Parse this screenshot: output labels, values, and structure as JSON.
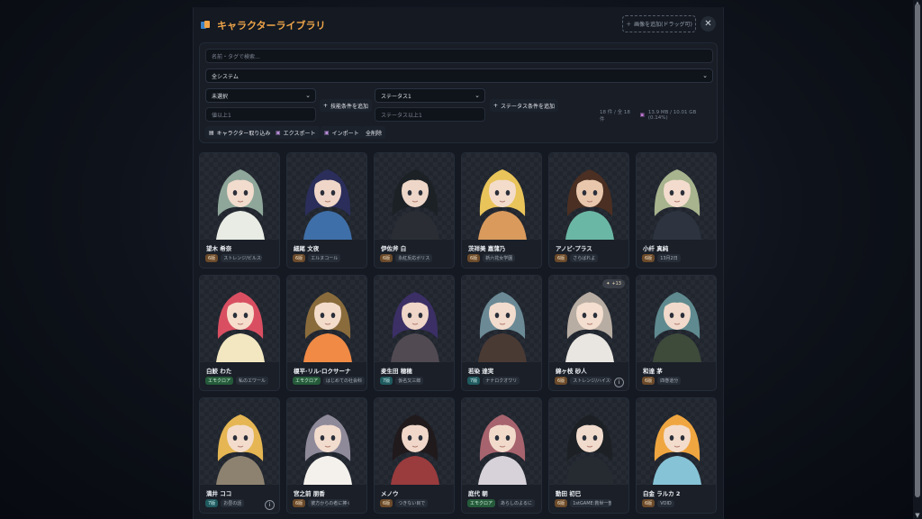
{
  "header": {
    "title": "キャラクターライブラリ",
    "add_label": "画像を追加(ドラッグ可)"
  },
  "filters": {
    "search_placeholder": "名前・タグで検索...",
    "system_select": "全システム",
    "skill_select": "未選択",
    "skill_add": "技能条件を追加",
    "skill_min_placeholder": "値以上1",
    "status_select": "ステータス1",
    "status_add": "ステータス条件を追加",
    "status_min_placeholder": "ステータス以上1",
    "count_text": "18 件 / 全 18 件",
    "storage_text": "13.9 MB / 10.01 GB (0.14%)",
    "actions": {
      "import_char": "キャラクター取り込み",
      "export": "エクスポート",
      "import": "インポート",
      "delete_all": "全削除"
    }
  },
  "cards": [
    {
      "name": "望木 希奈",
      "badge": "6版",
      "badge_style": "orange",
      "tag": "ストレンジ/ビルスクール",
      "hair": "#8fa79a",
      "skin": "#f2dccd",
      "cloth": "#e8ece4",
      "info": false,
      "tip": ""
    },
    {
      "name": "細尾 文夜",
      "badge": "6版",
      "badge_style": "orange",
      "tag": "エルヌコール",
      "hair": "#2b2e5a",
      "skin": "#f0d6c8",
      "cloth": "#3f6fa8",
      "info": false,
      "tip": ""
    },
    {
      "name": "伊佐斧 白",
      "badge": "6版",
      "badge_style": "orange",
      "tag": "永紅反応ボリス",
      "hair": "#1c2126",
      "skin": "#eed7c8",
      "cloth": "#2a2d33",
      "info": false,
      "tip": ""
    },
    {
      "name": "茨祥美 嘉蒲乃",
      "badge": "6版",
      "badge_style": "orange",
      "tag": "新六花女学園",
      "hair": "#e9c45a",
      "skin": "#f4dccb",
      "cloth": "#d99a5c",
      "info": false,
      "tip": ""
    },
    {
      "name": "アノビ·プラス",
      "badge": "6版",
      "badge_style": "orange",
      "tag": "さらばれよ",
      "hair": "#4a2f22",
      "skin": "#e9c7ad",
      "cloth": "#6bb7a5",
      "info": false,
      "tip": ""
    },
    {
      "name": "小纤 真純",
      "badge": "6版",
      "badge_style": "orange",
      "tag": "13月2日",
      "hair": "#a7b48e",
      "skin": "#f3dccd",
      "cloth": "#2d3440",
      "info": false,
      "tip": ""
    },
    {
      "name": "白鮫 わた",
      "badge": "エモクロア",
      "badge_style": "green",
      "tag": "私のエワール",
      "hair": "#d94f61",
      "skin": "#f6ddcc",
      "cloth": "#f2e7c0",
      "info": false,
      "tip": ""
    },
    {
      "name": "榎平·リル·ロクサーナ",
      "badge": "エモクロア",
      "badge_style": "green",
      "tag": "はじめての社会科",
      "hair": "#8a6c3c",
      "skin": "#f4dccb",
      "cloth": "#f08a45",
      "info": false,
      "tip": ""
    },
    {
      "name": "麦生田 穂穂",
      "badge": "7版",
      "badge_style": "teal",
      "tag": "仮名又三郎",
      "hair": "#3b2f66",
      "skin": "#f0d6c8",
      "cloth": "#514a52",
      "info": false,
      "tip": ""
    },
    {
      "name": "若染 達実",
      "badge": "7版",
      "badge_style": "teal",
      "tag": "ナナロクオワリ",
      "hair": "#6b8a96",
      "skin": "#f2dccd",
      "cloth": "#4a3a34",
      "info": false,
      "tip": ""
    },
    {
      "name": "錦ヶ枝 砂人",
      "badge": "6版",
      "badge_style": "orange",
      "tag": "ストレンジ/ハイスクール",
      "hair": "#b8ada3",
      "skin": "#f3decf",
      "cloth": "#e9e5e0",
      "info": true,
      "tip": "+13"
    },
    {
      "name": "和達 茅",
      "badge": "6版",
      "badge_style": "orange",
      "tag": "四巻道分",
      "hair": "#5f8a8f",
      "skin": "#f1dacb",
      "cloth": "#3e4a3a",
      "info": false,
      "tip": ""
    },
    {
      "name": "満井 ココ",
      "badge": "7版",
      "badge_style": "teal",
      "tag": "お昼の話",
      "hair": "#e5b653",
      "skin": "#f3dccb",
      "cloth": "#8d8270",
      "info": true,
      "tip": ""
    },
    {
      "name": "宮之前 朋香",
      "badge": "6版",
      "badge_style": "orange",
      "tag": "彼方からの者に捧ぐ",
      "hair": "#8f8a9a",
      "skin": "#f2dccd",
      "cloth": "#f4f1ec",
      "info": false,
      "tip": ""
    },
    {
      "name": "メノウ",
      "badge": "6版",
      "badge_style": "orange",
      "tag": "つきない目で",
      "hair": "#201a1c",
      "skin": "#f0d7c9",
      "cloth": "#9a3b3d",
      "info": false,
      "tip": ""
    },
    {
      "name": "庭代 朝",
      "badge": "エモクロア",
      "badge_style": "green",
      "tag": "あらしのよるに",
      "hair": "#a7646e",
      "skin": "#f2dacb",
      "cloth": "#d7d2d9",
      "info": false,
      "tip": ""
    },
    {
      "name": "動田 初巳",
      "badge": "6版",
      "badge_style": "orange",
      "tag": "1stGAME:救世一部",
      "hair": "#1d2125",
      "skin": "#f1dbcc",
      "cloth": "#262a31",
      "info": false,
      "tip": ""
    },
    {
      "name": "白金 ラルカ 2",
      "badge": "6版",
      "badge_style": "orange",
      "tag": "VOID",
      "hair": "#f0a640",
      "skin": "#f3dccb",
      "cloth": "#86c3d6",
      "info": false,
      "tip": ""
    }
  ]
}
